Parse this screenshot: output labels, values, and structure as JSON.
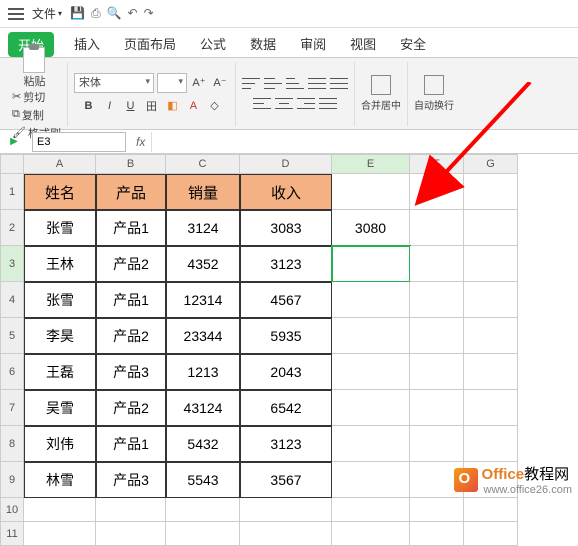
{
  "menubar": {
    "file": "文件"
  },
  "tabs": [
    "开始",
    "插入",
    "页面布局",
    "公式",
    "数据",
    "审阅",
    "视图",
    "安全"
  ],
  "active_tab_index": 0,
  "ribbon": {
    "paste": "粘贴",
    "cut": "剪切",
    "copy": "复制",
    "format_painter": "格式刷",
    "font_name": "宋体",
    "font_size": "",
    "merge_center": "合并居中",
    "wrap_text": "自动换行"
  },
  "namebox": "E3",
  "columns": [
    "A",
    "B",
    "C",
    "D",
    "E",
    "F",
    "G"
  ],
  "rows": [
    "1",
    "2",
    "3",
    "4",
    "5",
    "6",
    "7",
    "8",
    "9",
    "10",
    "11"
  ],
  "headers": [
    "姓名",
    "产品",
    "销量",
    "收入"
  ],
  "data": [
    [
      "张雪",
      "产品1",
      "3124",
      "3083"
    ],
    [
      "王林",
      "产品2",
      "4352",
      "3123"
    ],
    [
      "张雪",
      "产品1",
      "12314",
      "4567"
    ],
    [
      "李昊",
      "产品2",
      "23344",
      "5935"
    ],
    [
      "王磊",
      "产品3",
      "1213",
      "2043"
    ],
    [
      "吴雪",
      "产品2",
      "43124",
      "6542"
    ],
    [
      "刘伟",
      "产品1",
      "5432",
      "3123"
    ],
    [
      "林雪",
      "产品3",
      "5543",
      "3567"
    ]
  ],
  "extra": {
    "e2": "3080"
  },
  "active_cell": "E3",
  "watermark": {
    "brand": "Office",
    "suffix": "教程网",
    "url": "www.office26.com"
  }
}
